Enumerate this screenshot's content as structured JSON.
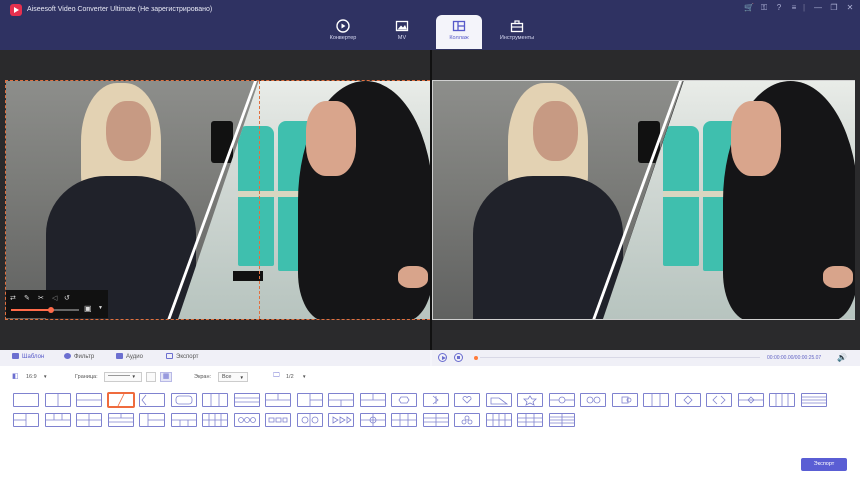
{
  "window": {
    "title": "Aiseesoft Video Converter Ultimate (Не зарегистрировано)"
  },
  "top_tabs": [
    {
      "label": "Конвертер",
      "icon": "convert-icon"
    },
    {
      "label": "MV",
      "icon": "image-icon"
    },
    {
      "label": "Коллаж",
      "icon": "collage-icon",
      "active": true
    },
    {
      "label": "Инструменты",
      "icon": "toolbox-icon"
    }
  ],
  "bottom_tabs": [
    {
      "label": "Шаблон",
      "active": true
    },
    {
      "label": "Фильтр"
    },
    {
      "label": "Аудио"
    },
    {
      "label": "Экспорт"
    }
  ],
  "player": {
    "time": "00:00:00.00/00:00:25.07"
  },
  "options": {
    "aspect": "16:9",
    "border_label": "Граница:",
    "screen_label": "Экран:",
    "screen_value": "Все",
    "page": "1/2"
  },
  "export_button": "Экспорт",
  "accent_color": "#5a5ed4",
  "selected_template_index": 3
}
